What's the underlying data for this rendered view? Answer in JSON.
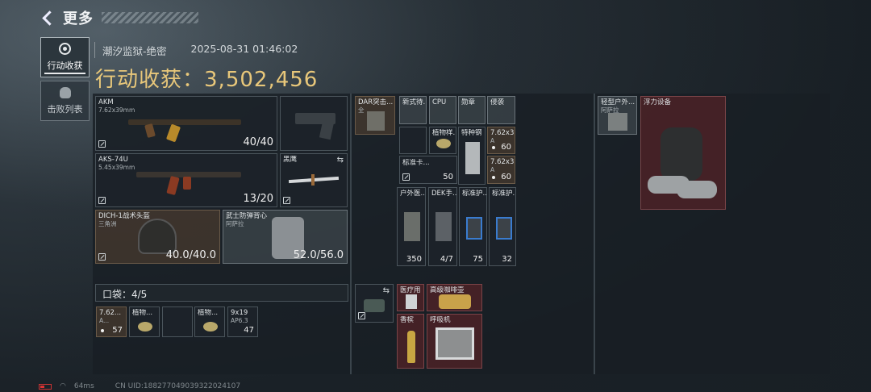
{
  "header": {
    "title": "更多"
  },
  "tabs": [
    {
      "label": "行动收获"
    },
    {
      "label": "击败列表"
    }
  ],
  "meta": {
    "map": "潮汐监狱-绝密",
    "datetime": "2025-08-31 01:46:02"
  },
  "gain": {
    "label": "行动收获：",
    "value": "3,502,456"
  },
  "weapons": {
    "w1": {
      "name": "AKM",
      "caliber": "7.62x39mm",
      "ammo": "40/40"
    },
    "w2": {
      "name": "AKS-74U",
      "caliber": "5.45x39mm",
      "ammo": "13/20"
    },
    "melee": {
      "name": "黑鹰"
    }
  },
  "helmet": {
    "name": "DICH-1战术头盔",
    "sub": "三角洲",
    "durability": "40.0/40.0"
  },
  "armor": {
    "name": "武士防弹背心",
    "sub": "阿萨拉",
    "durability": "52.0/56.0"
  },
  "pocket": {
    "label": "口袋：4/5",
    "items": [
      {
        "name": "7.62...",
        "sub": "A...",
        "count": "57"
      },
      {
        "name": "植物...",
        "count": ""
      },
      {
        "name": "",
        "count": ""
      },
      {
        "name": "植物...",
        "count": ""
      },
      {
        "name": "9x19",
        "sub": "AP6.3",
        "count": "47"
      }
    ]
  },
  "chest": {
    "name": "DAR突击...",
    "sub": "全"
  },
  "rig_items": [
    {
      "name": "新式待..."
    },
    {
      "name": "CPU"
    },
    {
      "name": "勋章"
    },
    {
      "name": "侵袭"
    },
    {
      "name": "植物样..."
    },
    {
      "name": "特种钢"
    },
    {
      "name": "7.62x3...",
      "sub": "A",
      "count": "60"
    },
    {
      "name": "7.62x3...",
      "sub": "A",
      "count": "60"
    },
    {
      "name": "标准卡...",
      "count": "50"
    },
    {
      "name": "户外医...",
      "count": "350"
    },
    {
      "name": "DEK手...",
      "count": "4/7"
    },
    {
      "name": "标准护...",
      "count": "75"
    },
    {
      "name": "标准护...",
      "count": "32"
    }
  ],
  "backpack_items": [
    {
      "name": "医疗用"
    },
    {
      "name": "高级咖啡壶"
    },
    {
      "name": "香槟"
    },
    {
      "name": "呼吸机"
    }
  ],
  "right_items": [
    {
      "name": "轻型户外...",
      "sub": "阿萨拉"
    },
    {
      "name": "浮力设备"
    }
  ],
  "status": {
    "ping": "64ms",
    "uid": "CN UID:18827704903932202410​7"
  }
}
